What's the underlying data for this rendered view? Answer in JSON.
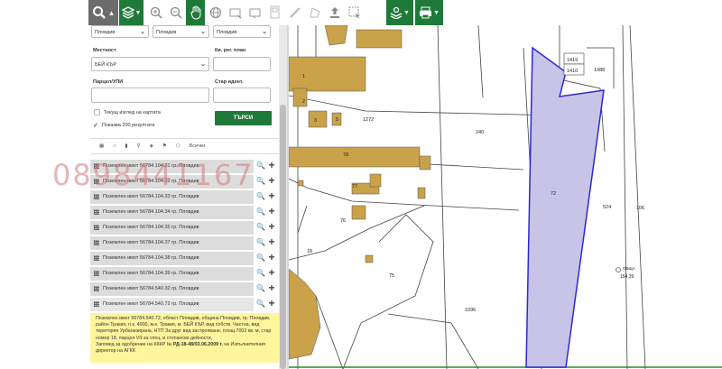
{
  "colors": {
    "accent": "#1f7a3a",
    "parcel_fill": "#c8c4e8",
    "parcel_border": "#2a2ad6",
    "building": "#c9a24a",
    "highlight": "#fff59d"
  },
  "toolbar": {
    "icons": [
      "search-icon",
      "layers-icon",
      "zoom-in-icon",
      "zoom-out-icon",
      "pan-hand-icon",
      "globe-icon",
      "measure-line-icon",
      "measure-area-icon",
      "document-icon",
      "ruler-icon",
      "polygon-icon",
      "upload-icon",
      "select-icon",
      "layers-switch-icon",
      "print-icon"
    ]
  },
  "filters": {
    "region_value": "Пловдив",
    "municipality_value": "Пловдив",
    "city_value": "Пловдив",
    "locality_label": "Местност",
    "locality_value": "БЕЙ КЪР",
    "reg_plan_label": "Кв. рег. план",
    "parcel_label": "Парцел/УПИ",
    "old_id_label": "Стар идент.",
    "current_view_label": "Текущ изглед на картата",
    "results_label": "Показва 200 резултата",
    "search_button": "ТЪРСИ"
  },
  "results_toolbar": {
    "all_label": "Всички"
  },
  "results": [
    "Поземлен имот 56784.104.31 гр. Пловдив",
    "Поземлен имот 56784.104.32 гр. Пловдив",
    "Поземлен имот 56784.104.33 гр. Пловдив",
    "Поземлен имот 56784.104.34 гр. Пловдив",
    "Поземлен имот 56784.104.35 гр. Пловдив",
    "Поземлен имот 56784.104.37 гр. Пловдив",
    "Поземлен имот 56784.104.38 гр. Пловдив",
    "Поземлен имот 56784.104.39 гр. Пловдив",
    "Поземлен имот 56784.540.32 гр. Пловдив",
    "Поземлен имот 56784.540.72 гр. Пловдив"
  ],
  "info": {
    "text": "Поземлен имот 56784.540.72, област Пловдив, община Пловдив, гр. Пловдив, район Тракия, п.к. 4000, м.к. Тракия, м. БЕЙ КЪР, вид собств. Частна, вид територия Урбанизирана, НТП За друг вид застрояване, площ 7002 кв. м, стар номер 18, парцел VII-за спец. и стопански дейности,",
    "decree_prefix": "Заповед за одобрение на КККР №",
    "decree_number": "РД-18-48/03.06.2009 г.",
    "decree_suffix": " на Изпълнителния директор на АГКК"
  },
  "watermark": "0898441167",
  "map": {
    "labels": [
      "1419",
      "1410",
      "1388",
      "240",
      "72",
      "524",
      "106",
      "1096",
      "75",
      "76",
      "18",
      "1272",
      "1",
      "2",
      "3",
      "5",
      "78",
      "77",
      "ОБЩА",
      "154,39"
    ]
  }
}
